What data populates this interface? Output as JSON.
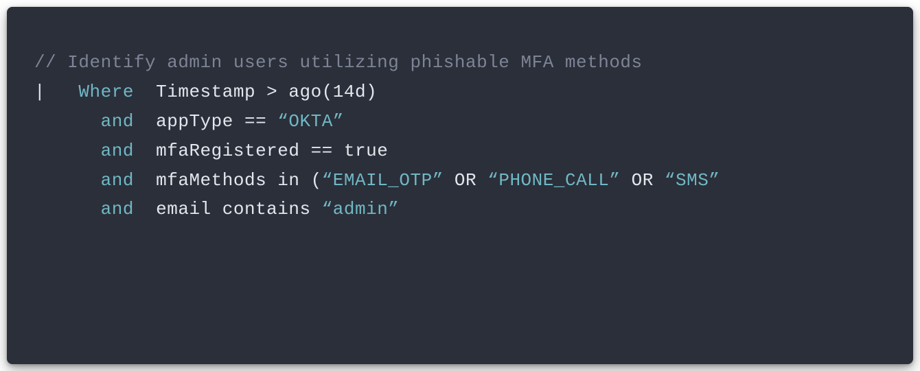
{
  "code": {
    "comment": "// Identify admin users utilizing phishable MFA methods",
    "line2_pipe": "|   ",
    "line2_where": "Where",
    "line2_rest": "  Timestamp > ago(14d)",
    "line3_indent": "      ",
    "line3_and": "and",
    "line3_text1": "  appType == ",
    "line3_string": "“OKTA”",
    "line4_indent": "      ",
    "line4_and": "and",
    "line4_text1": "  mfaRegistered == true",
    "line5_indent": "      ",
    "line5_and": "and",
    "line5_text1": "  mfaMethods in (",
    "line5_str1": "“EMAIL_OTP”",
    "line5_or1": " OR ",
    "line5_str2": "“PHONE_CALL”",
    "line5_or2": " OR ",
    "line5_str3": "“SMS”",
    "line6_indent": "      ",
    "line6_and": "and",
    "line6_text1": "  email contains ",
    "line6_string": "“admin”"
  }
}
